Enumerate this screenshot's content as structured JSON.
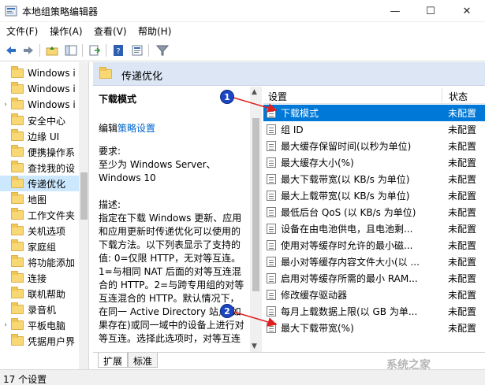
{
  "window": {
    "title": "本地组策略编辑器",
    "min": "—",
    "max": "☐",
    "close": "✕"
  },
  "menu": [
    "文件(F)",
    "操作(A)",
    "查看(V)",
    "帮助(H)"
  ],
  "tree": {
    "items": [
      {
        "label": "Windows i",
        "arrow": ""
      },
      {
        "label": "Windows i",
        "arrow": ""
      },
      {
        "label": "Windows i",
        "arrow": "›"
      },
      {
        "label": "安全中心",
        "arrow": ""
      },
      {
        "label": "边缘 UI",
        "arrow": ""
      },
      {
        "label": "便携操作系",
        "arrow": ""
      },
      {
        "label": "查找我的设",
        "arrow": ""
      },
      {
        "label": "传递优化",
        "arrow": "",
        "selected": true
      },
      {
        "label": "地图",
        "arrow": ""
      },
      {
        "label": "工作文件夹",
        "arrow": ""
      },
      {
        "label": "关机选项",
        "arrow": ""
      },
      {
        "label": "家庭组",
        "arrow": ""
      },
      {
        "label": "将功能添加",
        "arrow": ""
      },
      {
        "label": "连接",
        "arrow": ""
      },
      {
        "label": "联机帮助",
        "arrow": ""
      },
      {
        "label": "录音机",
        "arrow": ""
      },
      {
        "label": "平板电脑",
        "arrow": "›"
      },
      {
        "label": "凭据用户界",
        "arrow": ""
      }
    ]
  },
  "main": {
    "header_title": "传递优化",
    "desc": {
      "title": "下载模式",
      "edit_prefix": "编辑",
      "edit_link": "策略设置",
      "text": "要求:\n至少为 Windows Server、\nWindows 10\n\n描述:\n指定在下载 Windows 更新、应用和应用更新时传递优化可以使用的下载方法。以下列表显示了支持的值: 0=仅限 HTTP，无对等互连。1=与相同 NAT 后面的对等互连混合的 HTTP。2=与跨专用组的对等互连混合的 HTTP。默认情况下，在同一 Active Directory 站点(如果存在)或同一域中的设备上进行对等互连。选择此选项时，对等互连"
    },
    "list": {
      "col_setting": "设置",
      "col_state": "状态",
      "rows": [
        {
          "name": "下载模式",
          "state": "未配置",
          "selected": true
        },
        {
          "name": "组 ID",
          "state": "未配置"
        },
        {
          "name": "最大缓存保留时间(以秒为单位)",
          "state": "未配置"
        },
        {
          "name": "最大缓存大小(%)",
          "state": "未配置"
        },
        {
          "name": "最大下载带宽(以 KB/s 为单位)",
          "state": "未配置"
        },
        {
          "name": "最大上载带宽(以 KB/s 为单位)",
          "state": "未配置"
        },
        {
          "name": "最低后台 QoS (以 KB/s 为单位)",
          "state": "未配置"
        },
        {
          "name": "设备在由电池供电，且电池剩...",
          "state": "未配置"
        },
        {
          "name": "使用对等缓存时允许的最小磁...",
          "state": "未配置"
        },
        {
          "name": "最小对等缓存内容文件大小(以 ...",
          "state": "未配置"
        },
        {
          "name": "启用对等缓存所需的最小 RAM...",
          "state": "未配置"
        },
        {
          "name": "修改缓存驱动器",
          "state": "未配置"
        },
        {
          "name": "每月上载数据上限(以 GB 为单...",
          "state": "未配置"
        },
        {
          "name": "最大下载带宽(%)",
          "state": "未配置"
        }
      ]
    },
    "tabs": [
      "扩展",
      "标准"
    ]
  },
  "status": "17 个设置",
  "callouts": [
    "1",
    "2"
  ],
  "watermark": "系统之家",
  "colors": {
    "selection": "#0078d7",
    "tree_selection": "#cce8ff",
    "header_bg": "#dce6f4",
    "link": "#0066cc",
    "callout": "#1c47c2",
    "arrow": "#e02020"
  }
}
